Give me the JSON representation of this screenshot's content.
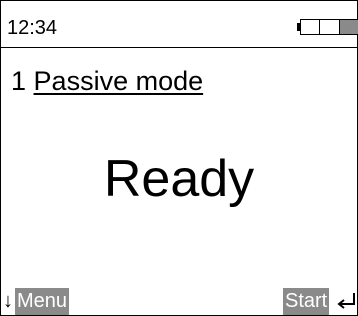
{
  "status_bar": {
    "time": "12:34",
    "battery_icon": "battery-icon",
    "battery_level": 0.33
  },
  "mode": {
    "number": "1",
    "name": "Passive mode"
  },
  "main": {
    "status": "Ready"
  },
  "softkeys": {
    "left_icon": "arrow-down-icon",
    "left_label": "Menu",
    "right_label": "Start",
    "right_icon": "enter-icon"
  },
  "colors": {
    "softkey_background": "#8a8a8a",
    "softkey_text": "#ffffff",
    "foreground": "#000000",
    "background": "#ffffff"
  }
}
